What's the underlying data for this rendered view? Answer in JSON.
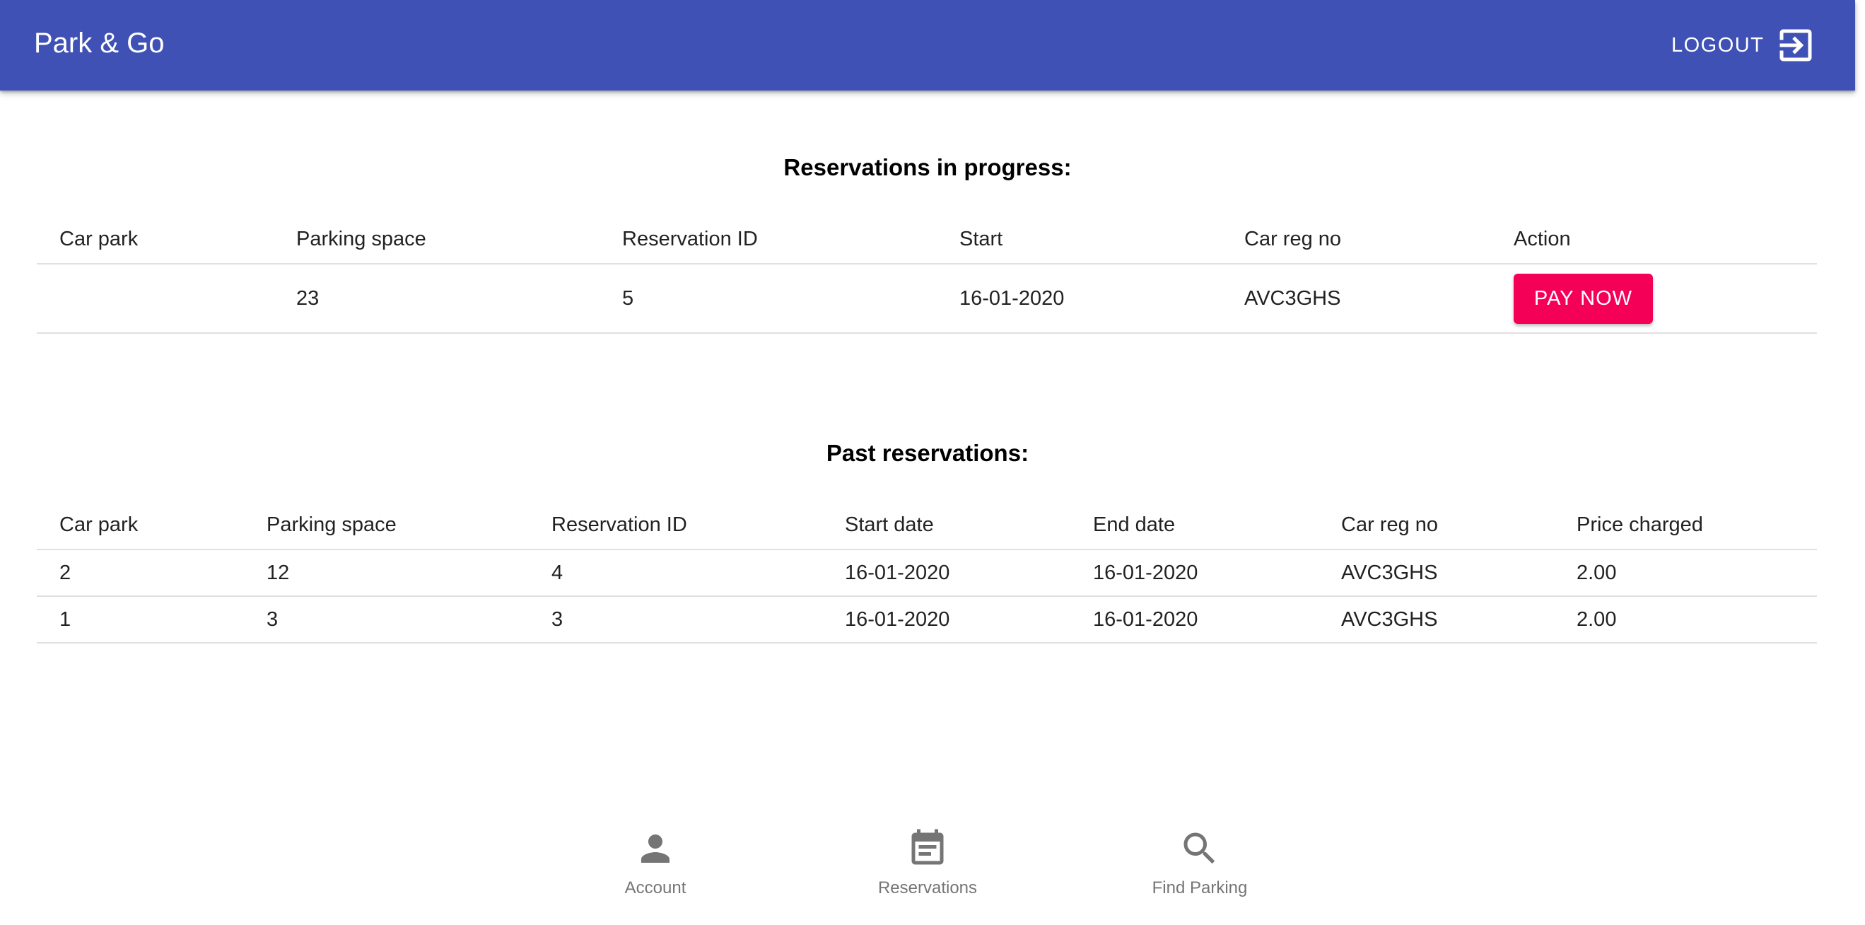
{
  "app": {
    "title": "Park & Go",
    "logout_label": "LOGOUT",
    "brand_color": "#3f51b5",
    "accent_color": "#f50057"
  },
  "in_progress": {
    "title": "Reservations in progress:",
    "columns": [
      "Car park",
      "Parking space",
      "Reservation ID",
      "Start",
      "Car reg no",
      "Action"
    ],
    "rows": [
      {
        "car_park": "",
        "parking_space": "23",
        "reservation_id": "5",
        "start": "16-01-2020",
        "car_reg_no": "AVC3GHS",
        "action_label": "PAY NOW"
      }
    ]
  },
  "past": {
    "title": "Past reservations:",
    "columns": [
      "Car park",
      "Parking space",
      "Reservation ID",
      "Start date",
      "End date",
      "Car reg no",
      "Price charged"
    ],
    "rows": [
      {
        "car_park": "2",
        "parking_space": "12",
        "reservation_id": "4",
        "start_date": "16-01-2020",
        "end_date": "16-01-2020",
        "car_reg_no": "AVC3GHS",
        "price": "2.00"
      },
      {
        "car_park": "1",
        "parking_space": "3",
        "reservation_id": "3",
        "start_date": "16-01-2020",
        "end_date": "16-01-2020",
        "car_reg_no": "AVC3GHS",
        "price": "2.00"
      }
    ]
  },
  "bottom_nav": {
    "items": [
      {
        "label": "Account",
        "icon": "person-icon"
      },
      {
        "label": "Reservations",
        "icon": "calendar-icon"
      },
      {
        "label": "Find Parking",
        "icon": "search-icon"
      }
    ]
  }
}
